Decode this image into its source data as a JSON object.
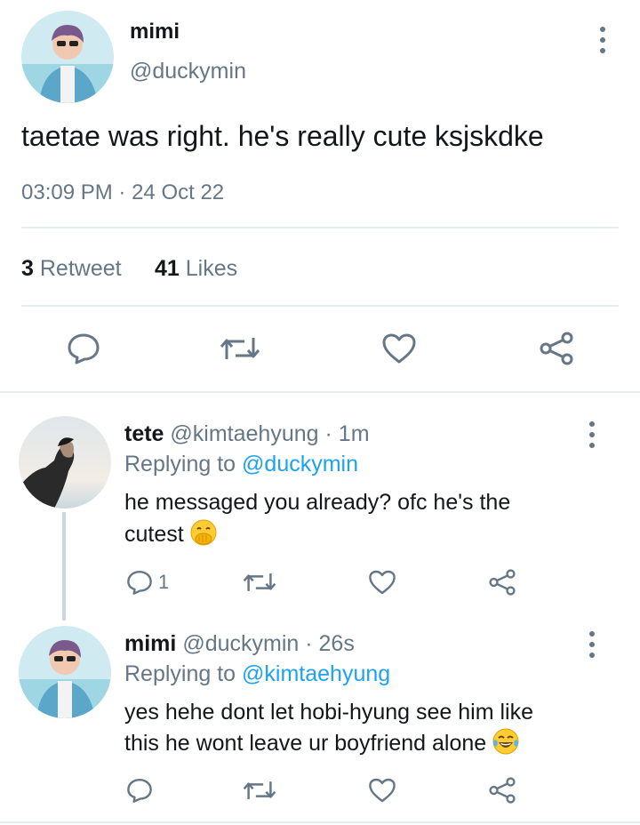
{
  "main_tweet": {
    "display_name": "mimi",
    "handle": "@duckymin",
    "text": "taetae was right. he's really cute ksjskdke",
    "time": "03:09 PM",
    "separator": "·",
    "date": "24 Oct 22",
    "retweet_count": "3",
    "retweet_label": "Retweet",
    "likes_count": "41",
    "likes_label": "Likes"
  },
  "replies": [
    {
      "display_name": "tete",
      "handle": "@kimtaehyung",
      "separator": "·",
      "time": "1m",
      "replying_label": "Replying to",
      "replying_to": "@duckymin",
      "text_line1": "he messaged you already? ofc he's the",
      "text_line2": "cutest",
      "emoji": "hand-over-mouth-emoji",
      "reply_count": "1"
    },
    {
      "display_name": "mimi",
      "handle": "@duckymin",
      "separator": "·",
      "time": "26s",
      "replying_label": "Replying to",
      "replying_to": "@kimtaehyung",
      "text_line1": "yes hehe dont let hobi-hyung see him like",
      "text_line2": "this he wont leave ur boyfriend alone",
      "emoji": "tears-of-joy-emoji",
      "reply_count": ""
    }
  ],
  "colors": {
    "text": "#14171a",
    "secondary": "#657786",
    "link": "#1da1f2",
    "divider": "#e6ecf0"
  }
}
